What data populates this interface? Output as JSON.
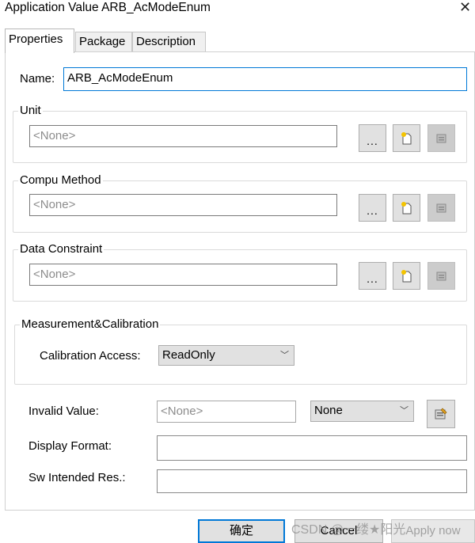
{
  "window": {
    "title": "Application Value ARB_AcModeEnum"
  },
  "tabs": [
    {
      "label": "Properties"
    },
    {
      "label": "Package"
    },
    {
      "label": "Description"
    }
  ],
  "name_field": {
    "label": "Name:",
    "value": "ARB_AcModeEnum"
  },
  "unit": {
    "legend": "Unit",
    "placeholder": "<None>"
  },
  "compu_method": {
    "legend": "Compu Method",
    "placeholder": "<None>"
  },
  "data_constraint": {
    "legend": "Data Constraint",
    "placeholder": "<None>"
  },
  "measurement": {
    "legend": "Measurement&Calibration",
    "access_label": "Calibration Access:",
    "access_value": "ReadOnly"
  },
  "invalid_value": {
    "label": "Invalid Value:",
    "placeholder": "<None>",
    "combo_value": "None"
  },
  "display_format": {
    "label": "Display Format:",
    "value": ""
  },
  "sw_intended": {
    "label": "Sw Intended Res.:",
    "value": ""
  },
  "buttons": {
    "ellipsis": "...",
    "ok": "确定",
    "cancel": "Cancel",
    "apply": "Apply now"
  },
  "watermark": "CSDN @一缕★阳光",
  "icons": {
    "close": "close-icon",
    "new": "new-document-icon",
    "edit": "edit-properties-icon",
    "dropdown": "chevron-down-icon"
  },
  "colors": {
    "focus_border": "#0078d7",
    "button_face": "#e1e1e1",
    "placeholder_text": "#8c8c8c"
  }
}
